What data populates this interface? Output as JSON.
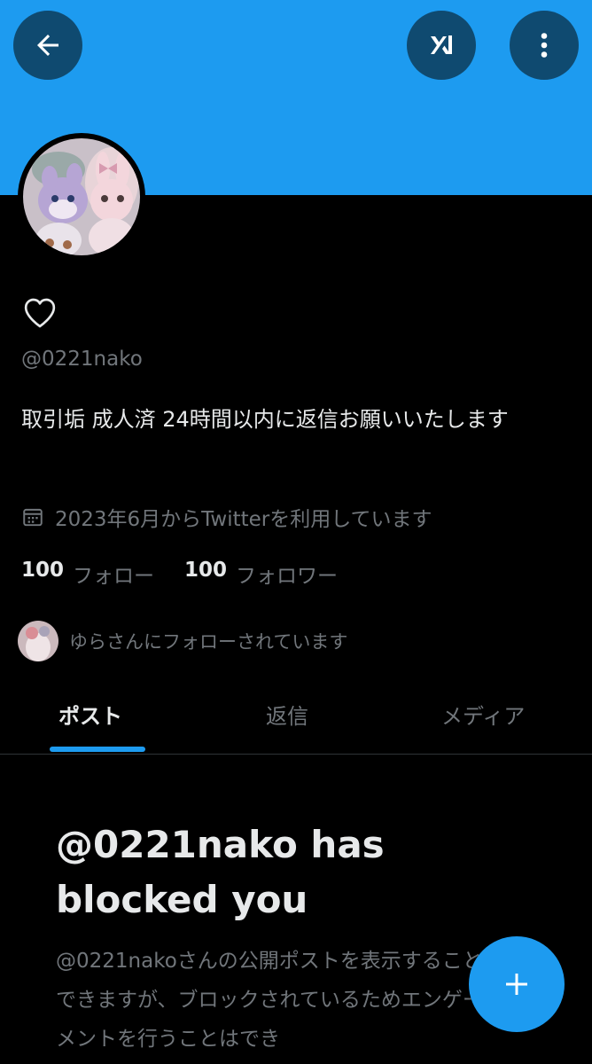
{
  "profile": {
    "handle": "@0221nako",
    "bio": "取引垢 成人済 24時間以内に返信お願いいたします",
    "joined": "2023年6月からTwitterを利用しています",
    "following_count": "100",
    "following_label": "フォロー",
    "followers_count": "100",
    "followers_label": "フォロワー",
    "followed_by": "ゆらさんにフォローされています"
  },
  "tabs": [
    {
      "label": "ポスト",
      "active": true
    },
    {
      "label": "返信",
      "active": false
    },
    {
      "label": "メディア",
      "active": false
    }
  ],
  "blocked": {
    "title": "@0221nako has blocked you",
    "description": "@0221nakoさんの公開ポストを表示することはできますが、ブロックされているためエンゲージメントを行うことはでき"
  },
  "icons": {
    "back": "back-arrow-icon",
    "grok": "grok-icon",
    "more": "more-vertical-icon",
    "heart": "heart-icon",
    "calendar": "calendar-icon",
    "compose": "plus-icon"
  },
  "colors": {
    "accent": "#1d9bf0",
    "background": "#000000",
    "text": "#e7e9ea",
    "muted": "#71767b"
  }
}
